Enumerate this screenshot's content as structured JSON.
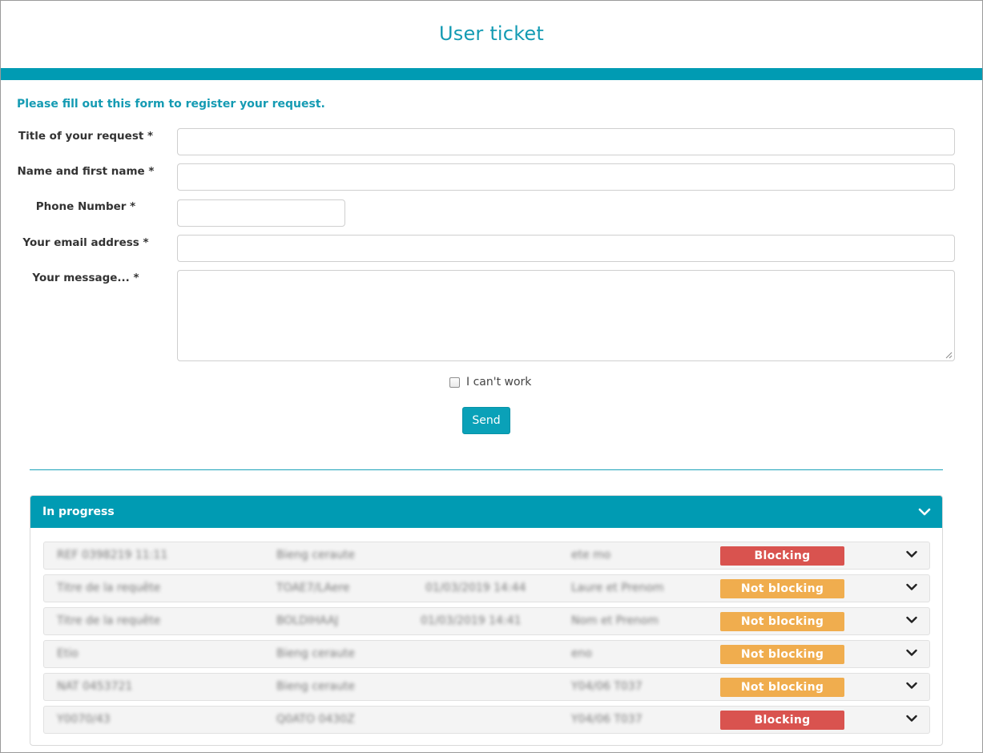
{
  "header": {
    "title": "User ticket",
    "accent_color": "#009bb3"
  },
  "form": {
    "intro": "Please fill out this form to register your request.",
    "fields": [
      {
        "label": "Title of your request *",
        "value": "",
        "placeholder": ""
      },
      {
        "label": "Name and first name *",
        "value": "",
        "placeholder": ""
      },
      {
        "label": "Phone Number *",
        "value": "",
        "placeholder": ""
      },
      {
        "label": "Your email address *",
        "value": "",
        "placeholder": ""
      },
      {
        "label": "Your message... *",
        "value": "",
        "placeholder": ""
      }
    ],
    "checkbox_label": "I can't work",
    "checkbox_checked": false,
    "send_label": "Send"
  },
  "panel": {
    "title": "In progress",
    "icon": "chevron-down-icon",
    "rows": [
      {
        "c1": "REF 0398219 11:11",
        "c2": "Bieng ceraute",
        "c3": "",
        "c4": "ete mo",
        "priority": "Blocking",
        "priority_color": "#d9534f"
      },
      {
        "c1": "Titre de la requête",
        "c2": "TOAE7/LAere",
        "c3": "01/03/2019 14:44",
        "c4": "Laure et Prenom",
        "priority": "Not blocking",
        "priority_color": "#f0ad4e"
      },
      {
        "c1": "Titre de la requête",
        "c2": "BOLDIHAAJ",
        "c3": "01/03/2019 14:41",
        "c4": "Nom et Prenom",
        "priority": "Not blocking",
        "priority_color": "#f0ad4e"
      },
      {
        "c1": "Etio",
        "c2": "Bieng ceraute",
        "c3": "",
        "c4": "eno",
        "priority": "Not blocking",
        "priority_color": "#f0ad4e"
      },
      {
        "c1": "NAT 0453721",
        "c2": "Bieng ceraute",
        "c3": "",
        "c4": "Y04/06 T037",
        "priority": "Not blocking",
        "priority_color": "#f0ad4e"
      },
      {
        "c1": "Y0070/43",
        "c2": "Q0ATO 0430Z",
        "c3": "",
        "c4": "Y04/06 T037",
        "priority": "Blocking",
        "priority_color": "#d9534f"
      }
    ]
  }
}
